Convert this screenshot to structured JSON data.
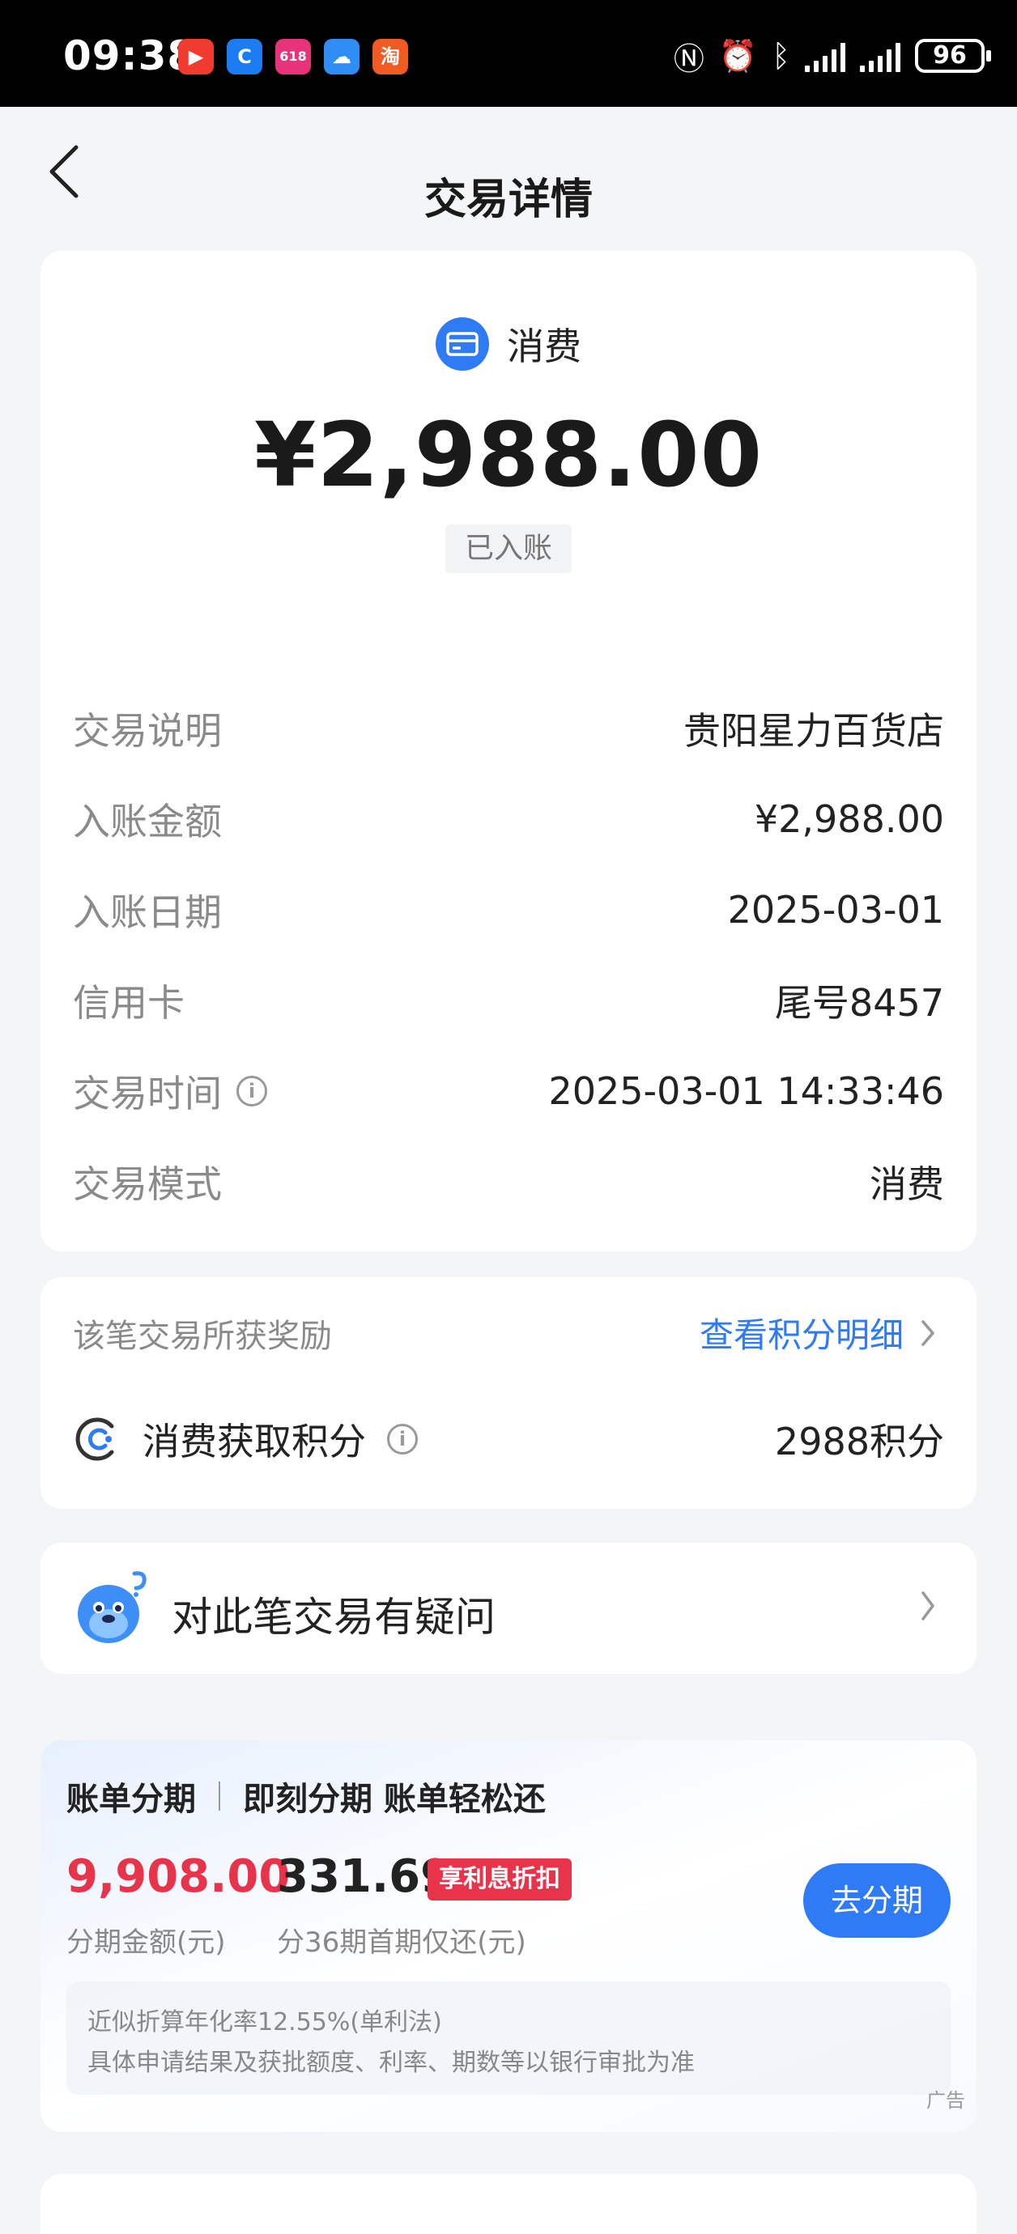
{
  "status_bar": {
    "time": "09:38",
    "battery": "96",
    "apps": [
      {
        "name": "video-app",
        "color": "#f23b2f",
        "glyph": "▶"
      },
      {
        "name": "browser-app",
        "color": "#1d7cf2",
        "glyph": "C"
      },
      {
        "name": "shop-app",
        "color": "#e6337a",
        "glyph": "618"
      },
      {
        "name": "weather-app",
        "color": "#2f8ef5",
        "glyph": "☁"
      },
      {
        "name": "taobao-app",
        "color": "#f05a23",
        "glyph": "淘"
      }
    ]
  },
  "nav": {
    "title": "交易详情"
  },
  "transaction": {
    "type_label": "消费",
    "amount": "¥2,988.00",
    "status": "已入账",
    "details": [
      {
        "label": "交易说明",
        "value": "贵阳星力百货店"
      },
      {
        "label": "入账金额",
        "value": "¥2,988.00"
      },
      {
        "label": "入账日期",
        "value": "2025-03-01"
      },
      {
        "label": "信用卡",
        "value": "尾号8457"
      },
      {
        "label": "交易时间",
        "value": "2025-03-01 14:33:46"
      },
      {
        "label": "交易模式",
        "value": "消费"
      }
    ]
  },
  "rewards": {
    "heading": "该笔交易所获奖励",
    "link": "查看积分明细",
    "item_label": "消费获取积分",
    "item_value": "2988积分"
  },
  "question": {
    "text": "对此笔交易有疑问"
  },
  "ad": {
    "title_left": "账单分期",
    "title_right": "即刻分期 账单轻松还",
    "amount": "9,908.00",
    "amount_label": "分期金额(元)",
    "monthly": "331.69",
    "tag": "享利息折扣",
    "monthly_label": "分36期首期仅还(元)",
    "button": "去分期",
    "note_line1": "近似折算年化率12.55%(单利法)",
    "note_line2": "具体申请结果及获批额度、利率、期数等以银行审批为准",
    "ad_label": "广告"
  },
  "colors": {
    "accent": "#2f7bf5",
    "highlight_red": "#e8344a",
    "background": "#f4f5f7"
  }
}
